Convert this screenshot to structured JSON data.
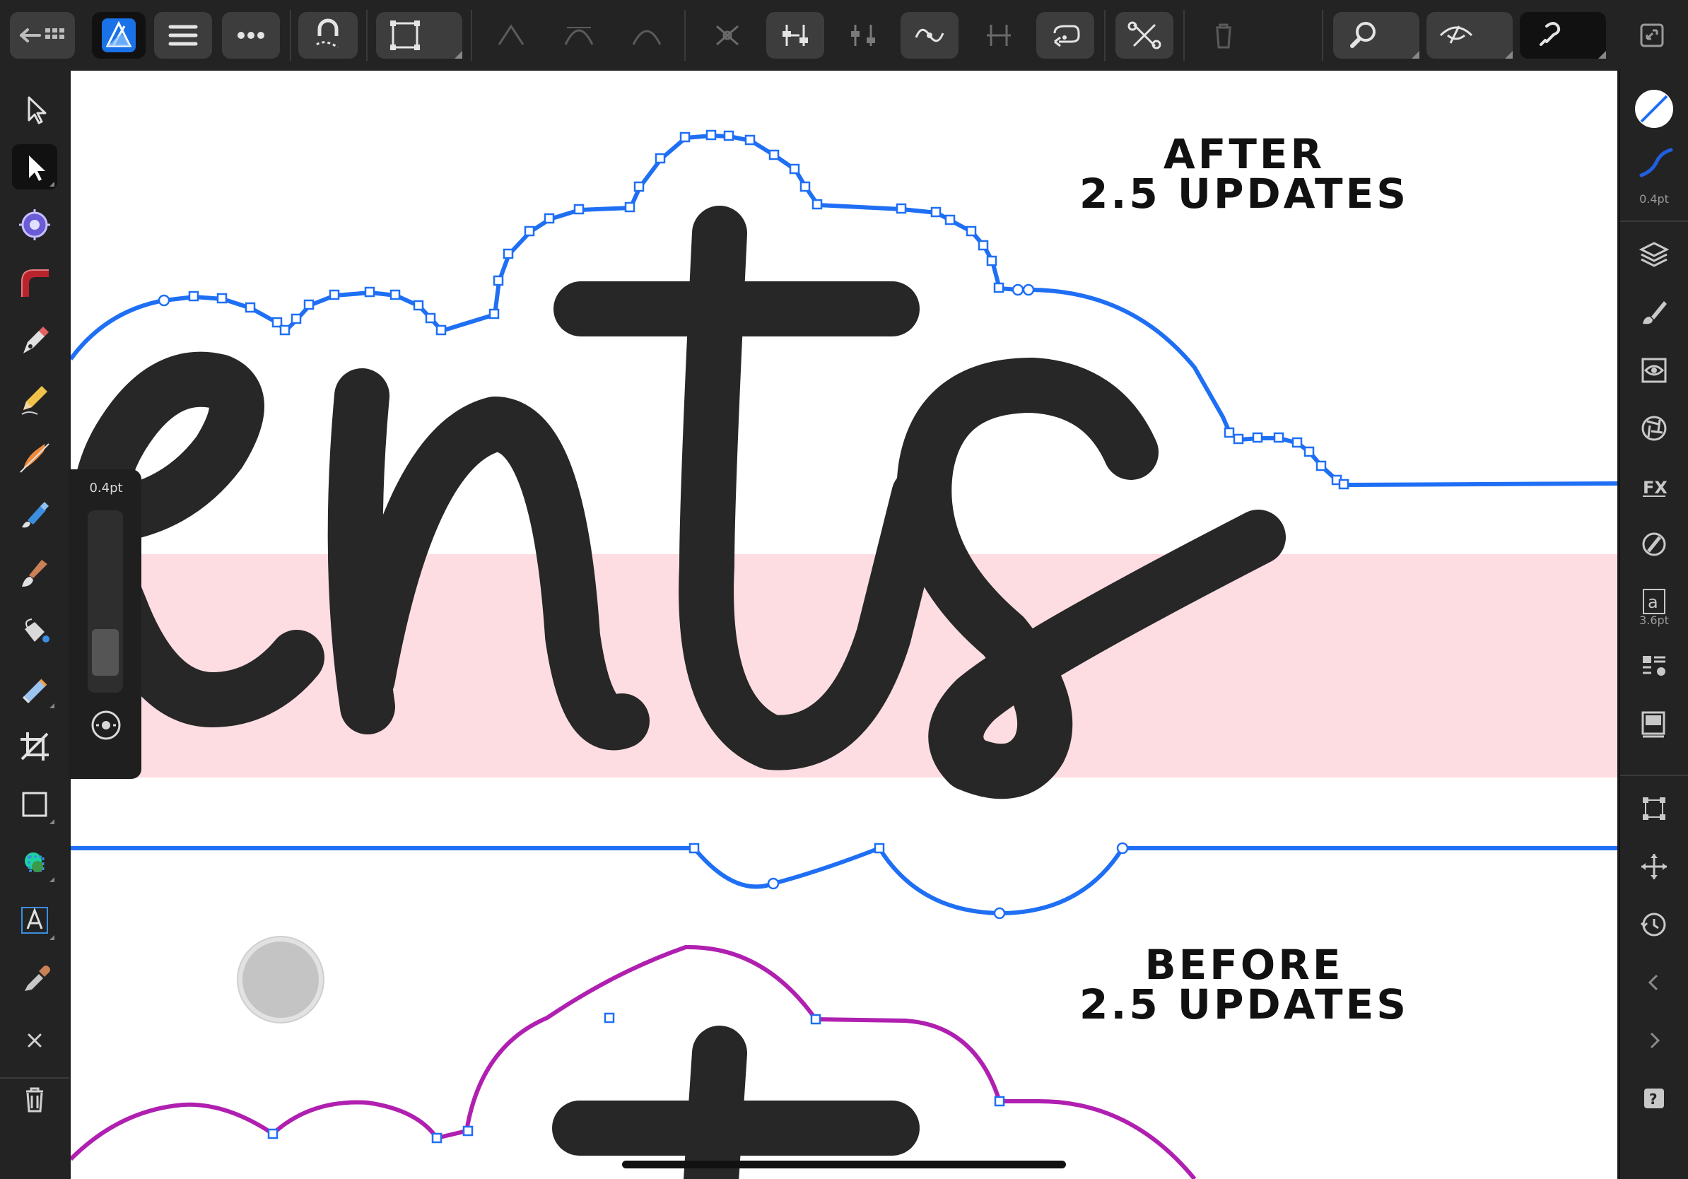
{
  "canvas": {
    "caption_after": [
      "AFTER",
      "2.5 UPDATES"
    ],
    "caption_before": [
      "BEFORE",
      "2.5 UPDATES"
    ],
    "lettering_text": "ents",
    "highlight_color": "#fddde2",
    "after_curve_color": "#1f6ff5",
    "before_curve_color": "#b020b0",
    "lettering_color": "#272727"
  },
  "width_slider": {
    "value_label": "0.4pt",
    "level": 0.08
  },
  "right_panel": {
    "stroke_width_label": "0.4pt",
    "text_size_label": "3.6pt"
  },
  "topbar": {
    "tools": [
      "back-to-gallery",
      "persona-designer",
      "document-menu",
      "more-menu",
      "snapping",
      "transform-mode",
      "sharp-node",
      "smooth-node",
      "smart-node",
      "break-curve",
      "align-nodes",
      "distribute-nodes",
      "convert-to-smooth",
      "join-curves",
      "reverse-curve",
      "close-curve",
      "delete-node",
      "zoom",
      "view-mode",
      "assistant",
      "fullscreen"
    ]
  },
  "left_tools": [
    "move",
    "node",
    "corner",
    "point-transform",
    "pen",
    "pencil",
    "vector-brush",
    "fill",
    "transparency",
    "vector-crop",
    "flood-fill",
    "color-picker",
    "crop",
    "rectangle",
    "shape-builder",
    "artistic-text",
    "eyedropper"
  ],
  "right_tools": [
    "stroke-color",
    "stroke-style",
    "layers",
    "brushes",
    "appearance",
    "effects",
    "fx",
    "color",
    "character",
    "paragraph",
    "assets",
    "transform",
    "navigator",
    "history",
    "collapse",
    "expand",
    "help"
  ]
}
